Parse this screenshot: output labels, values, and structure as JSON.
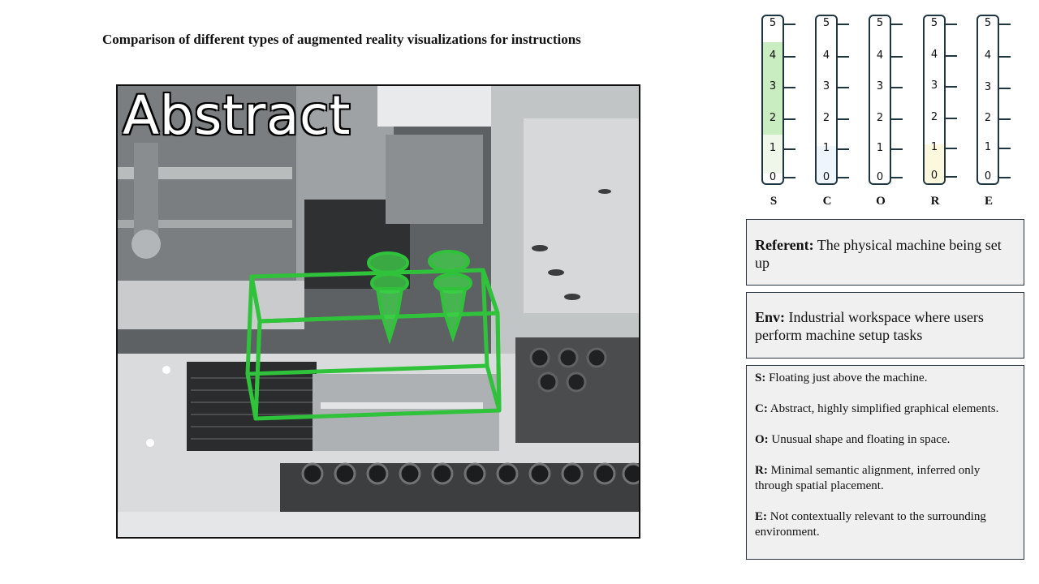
{
  "title": "Comparison of different types of augmented reality visualizations for instructions",
  "photo": {
    "label": "Abstract",
    "overlay_color": "#2fc23a"
  },
  "scales": [
    {
      "letter": "S",
      "levels": [
        "5",
        "4",
        "3",
        "2",
        "1",
        "0"
      ],
      "fill": [
        {
          "from": 1,
          "to": 4,
          "color": "#c9ecc0"
        },
        {
          "from": 0,
          "to": 1,
          "color": "#eef7ea"
        }
      ]
    },
    {
      "letter": "C",
      "levels": [
        "5",
        "4",
        "3",
        "2",
        "1",
        "0"
      ],
      "fill": [
        {
          "from": 0,
          "to": 1,
          "color": "#eef6fb"
        }
      ]
    },
    {
      "letter": "O",
      "levels": [
        "5",
        "4",
        "3",
        "2",
        "1",
        "0"
      ],
      "fill": []
    },
    {
      "letter": "R",
      "levels": [
        "5",
        "4",
        "3",
        "2",
        "1",
        "0"
      ],
      "fill": [
        {
          "from": 0,
          "to": 1,
          "color": "#fbf8de"
        }
      ]
    },
    {
      "letter": "E",
      "levels": [
        "5",
        "4",
        "3",
        "2",
        "1",
        "0"
      ],
      "fill": []
    }
  ],
  "referent": {
    "label": "Referent:",
    "text": " The physical machine being set up"
  },
  "env": {
    "label": "Env:",
    "text": " Industrial workspace where users perform machine setup tasks"
  },
  "descriptors": [
    {
      "key": "S:",
      "text": " Floating just above the machine."
    },
    {
      "key": "C:",
      "text": " Abstract, highly simplified graphical elements."
    },
    {
      "key": "O:",
      "text": " Unusual shape and floating in space."
    },
    {
      "key": "R:",
      "text": " Minimal semantic alignment, inferred only through spatial placement."
    },
    {
      "key": "E:",
      "text": " Not contextually relevant to the surrounding environment."
    }
  ]
}
